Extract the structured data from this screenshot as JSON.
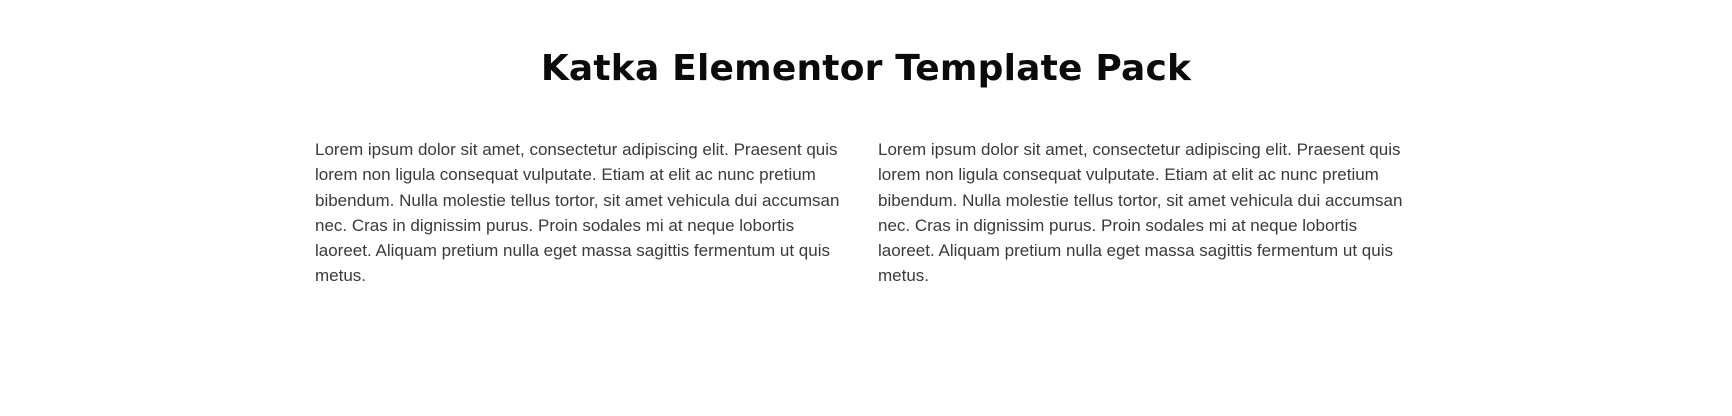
{
  "title": "Katka Elementor Template Pack",
  "columns": [
    {
      "text": "Lorem ipsum dolor sit amet, consectetur adipiscing elit. Praesent quis lorem non ligula consequat vulputate. Etiam at elit ac nunc pretium bibendum. Nulla molestie tellus tortor, sit amet vehicula dui accumsan nec. Cras in dignissim purus. Proin sodales mi at neque lobortis laoreet. Aliquam pretium nulla eget massa sagittis fermentum ut quis metus."
    },
    {
      "text": "Lorem ipsum dolor sit amet, consectetur adipiscing elit. Praesent quis lorem non ligula consequat vulputate. Etiam at elit ac nunc pretium bibendum. Nulla molestie tellus tortor, sit amet vehicula dui accumsan nec. Cras in dignissim purus. Proin sodales mi at neque lobortis laoreet. Aliquam pretium nulla eget massa sagittis fermentum ut quis metus."
    }
  ]
}
